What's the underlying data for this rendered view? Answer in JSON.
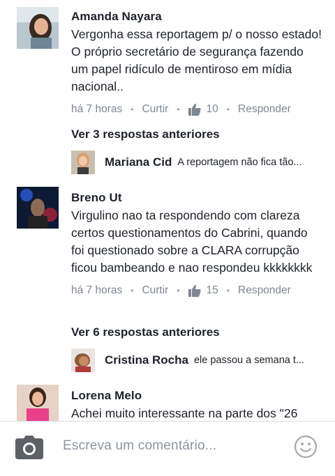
{
  "comments": [
    {
      "author": "Amanda Nayara",
      "text": "Vergonha essa reportagem p/ o nosso estado! O próprio secretário de segurança fazendo um papel ridículo de mentiroso em mídia nacional..",
      "time": "há 7 horas",
      "like_label": "Curtir",
      "likes": "10",
      "reply_label": "Responder",
      "more_replies": "Ver 3 respostas anteriores",
      "reply_preview": {
        "author": "Mariana Cid",
        "text": "A reportagem não fica tão..."
      }
    },
    {
      "author": "Breno Ut",
      "text": "Virgulino nao ta respondendo com clareza certos questionamentos do Cabrini, quando foi questionado sobre a CLARA corrupção ficou bambeando e nao respondeu kkkkkkkk",
      "time": "há 7 horas",
      "like_label": "Curtir",
      "likes": "15",
      "reply_label": "Responder",
      "more_replies": "Ver 6 respostas anteriores",
      "reply_preview": {
        "author": "Cristina Rocha",
        "text": "ele passou a semana t..."
      }
    },
    {
      "author": "Lorena Melo",
      "text": "Achei muito interessante na parte dos \"26"
    }
  ],
  "composer": {
    "placeholder": "Escreva um comentário...",
    "camera_icon": "camera-icon",
    "emoji_icon": "smiley-icon"
  },
  "colors": {
    "text": "#1d2129",
    "meta": "#7f8792",
    "divider": "#dadde1",
    "icon": "#90949c"
  }
}
